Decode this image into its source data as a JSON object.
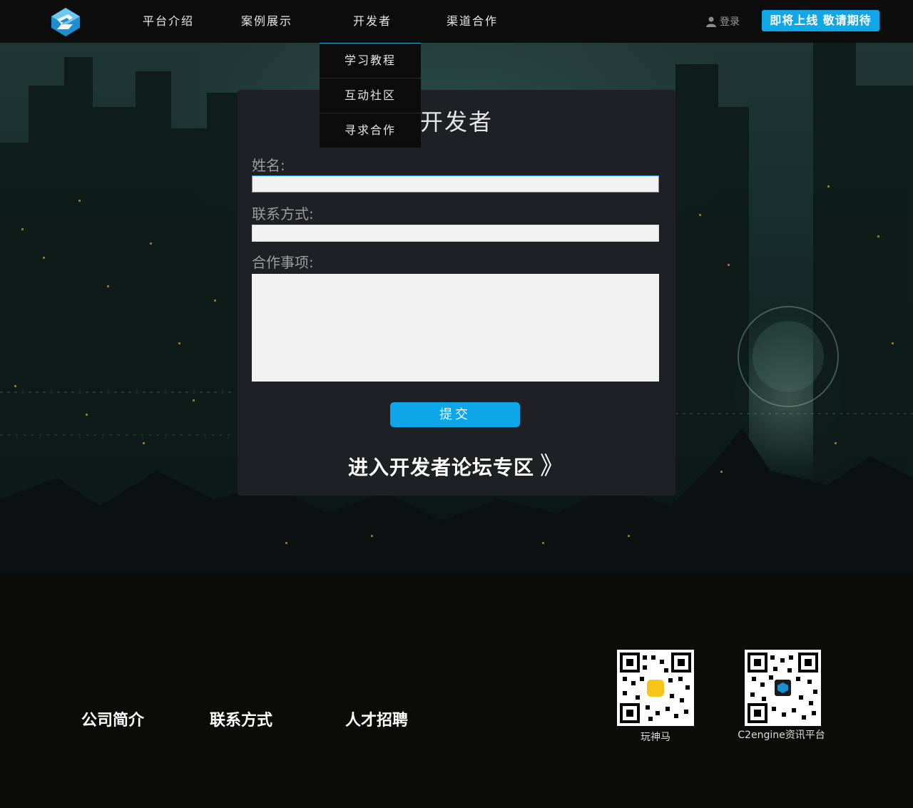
{
  "header": {
    "nav": [
      {
        "label": "平台介绍"
      },
      {
        "label": "案例展示"
      },
      {
        "label": "开发者"
      },
      {
        "label": "渠道合作"
      }
    ],
    "login_label": "登录",
    "cta_label": "即将上线  敬请期待"
  },
  "dropdown": {
    "items": [
      {
        "label": "学习教程"
      },
      {
        "label": "互动社区"
      },
      {
        "label": "寻求合作"
      }
    ]
  },
  "form": {
    "title": "开发者",
    "name_label": "姓名:",
    "name_value": "",
    "contact_label": "联系方式:",
    "contact_value": "",
    "matter_label": "合作事项:",
    "matter_value": "",
    "submit_label": "提交",
    "forum_label": "进入开发者论坛专区",
    "forum_arrow": "》"
  },
  "footer": {
    "links": [
      {
        "label": "公司简介"
      },
      {
        "label": "联系方式"
      },
      {
        "label": "人才招聘"
      }
    ],
    "qr_codes": [
      {
        "label": "玩神马"
      },
      {
        "label": "C2engine资讯平台"
      }
    ]
  },
  "colors": {
    "accent": "#0da6e8",
    "header_bg": "#0d0d0d",
    "panel_bg": "#1f2024",
    "footer_bg": "#0b0c0a"
  }
}
